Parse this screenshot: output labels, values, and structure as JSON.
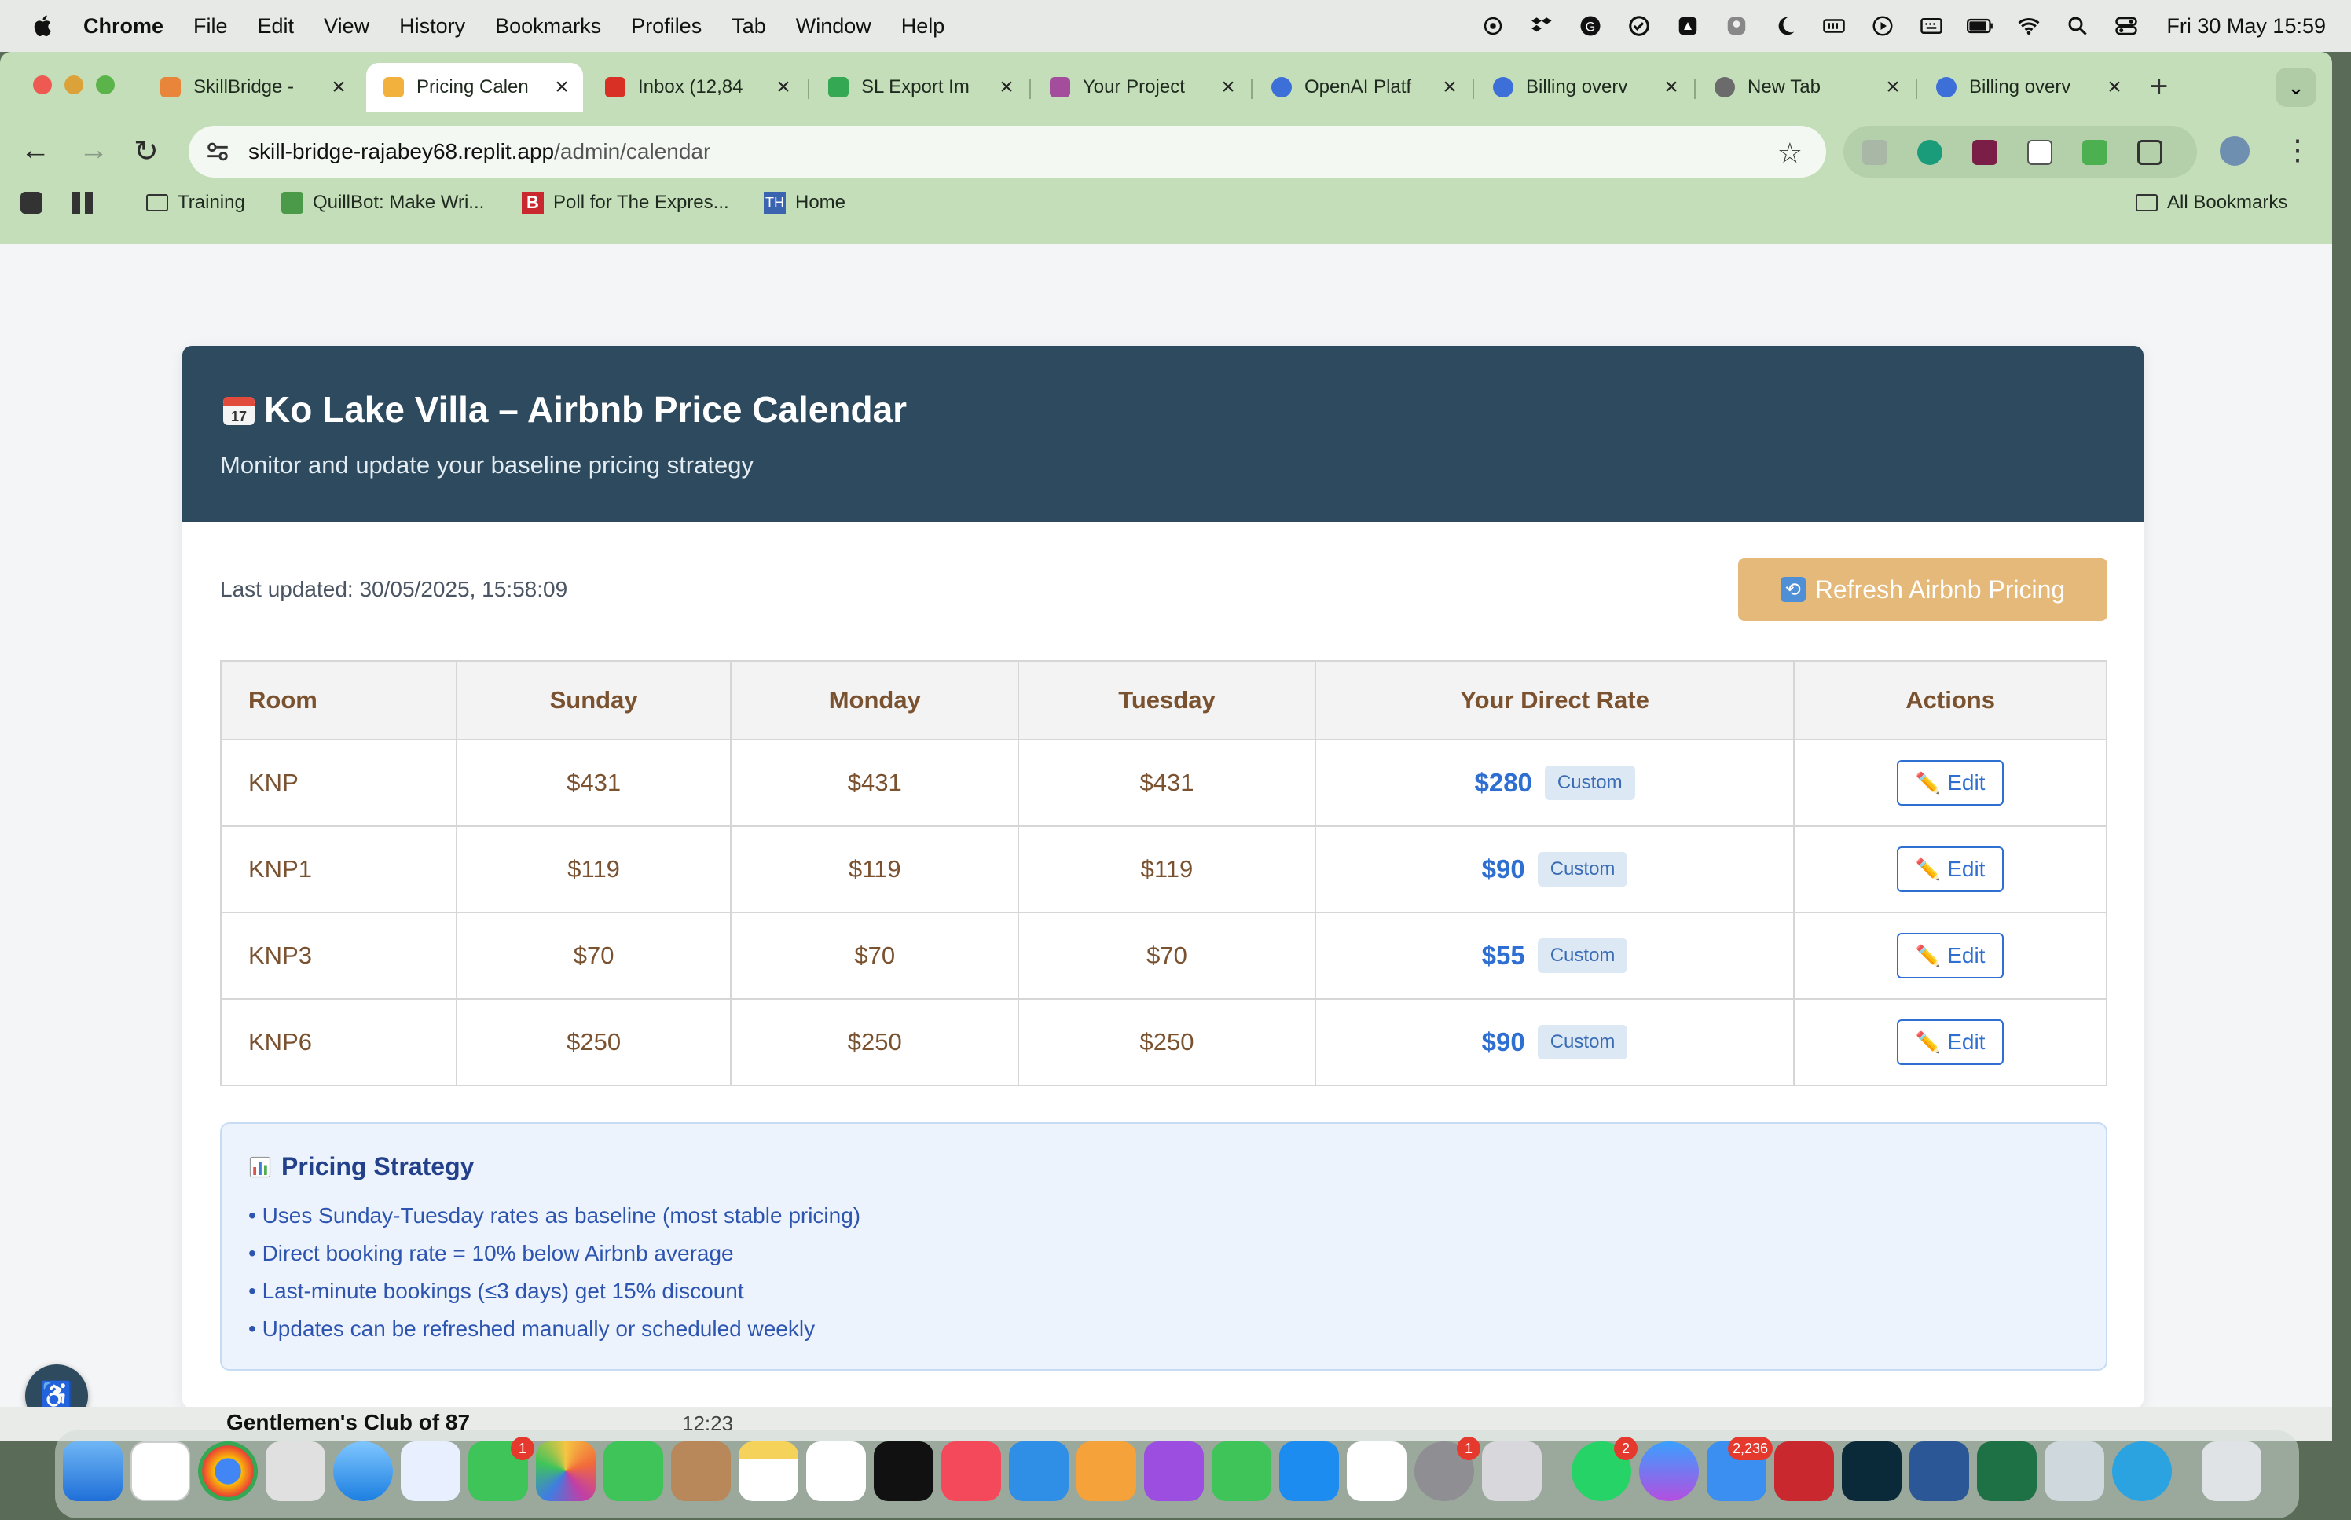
{
  "menubar": {
    "app_name": "Chrome",
    "items": [
      "File",
      "Edit",
      "View",
      "History",
      "Bookmarks",
      "Profiles",
      "Tab",
      "Window",
      "Help"
    ],
    "clock": "Fri 30 May  15:59"
  },
  "tabs": [
    {
      "title": "SkillBridge -",
      "color": "#e8853a"
    },
    {
      "title": "Pricing Calen",
      "color": "#f2b13c",
      "active": true
    },
    {
      "title": "Inbox (12,84",
      "color": "#d93025"
    },
    {
      "title": "SL Export Im",
      "color": "#34a853"
    },
    {
      "title": "Your Project",
      "color": "#a44d9c"
    },
    {
      "title": "OpenAI Platf",
      "color": "#3d6fd8"
    },
    {
      "title": "Billing overv",
      "color": "#3d6fd8"
    },
    {
      "title": "New Tab",
      "color": "#6b6b6b"
    },
    {
      "title": "Billing overv",
      "color": "#3d6fd8"
    }
  ],
  "omnibox": {
    "host": "skill-bridge-rajabey68.replit.app",
    "path": "/admin/calendar"
  },
  "bookmarks": [
    {
      "label": "Training",
      "icon": "folder-icon"
    },
    {
      "label": "QuillBot: Make Wri...",
      "icon": "quillbot-icon"
    },
    {
      "label": "Poll for The Expres...",
      "icon": "b-icon"
    },
    {
      "label": "Home",
      "icon": "th-icon"
    }
  ],
  "all_bookmarks": "All Bookmarks",
  "header": {
    "title": "Ko Lake Villa – Airbnb Price Calendar",
    "subtitle": "Monitor and update your baseline pricing strategy"
  },
  "last_updated": "Last updated: 30/05/2025, 15:58:09",
  "refresh_label": "Refresh Airbnb Pricing",
  "table": {
    "headers": [
      "Room",
      "Sunday",
      "Monday",
      "Tuesday",
      "Your Direct Rate",
      "Actions"
    ],
    "rows": [
      {
        "room": "KNP",
        "sunday": "$431",
        "monday": "$431",
        "tuesday": "$431",
        "direct": "$280",
        "badge": "Custom",
        "action": "Edit"
      },
      {
        "room": "KNP1",
        "sunday": "$119",
        "monday": "$119",
        "tuesday": "$119",
        "direct": "$90",
        "badge": "Custom",
        "action": "Edit"
      },
      {
        "room": "KNP3",
        "sunday": "$70",
        "monday": "$70",
        "tuesday": "$70",
        "direct": "$55",
        "badge": "Custom",
        "action": "Edit"
      },
      {
        "room": "KNP6",
        "sunday": "$250",
        "monday": "$250",
        "tuesday": "$250",
        "direct": "$90",
        "badge": "Custom",
        "action": "Edit"
      }
    ]
  },
  "strategy": {
    "title": "Pricing Strategy",
    "items": [
      "• Uses Sunday-Tuesday rates as baseline (most stable pricing)",
      "• Direct booking rate = 10% below Airbnb average",
      "• Last-minute bookings (≤3 days) get 15% discount",
      "• Updates can be refreshed manually or scheduled weekly"
    ]
  },
  "behind_window": {
    "title": "Gentlemen's Club of 87",
    "time": "12:23"
  },
  "dock": {
    "badges": {
      "messages": "1",
      "settings": "1",
      "whatsapp": "2",
      "mail": "2,236"
    }
  },
  "colors": {
    "header_bg": "#2d4a5e",
    "refresh_bg": "#e5b97a",
    "direct_rate": "#2f6fd1",
    "tab_bar": "#c4deba"
  }
}
